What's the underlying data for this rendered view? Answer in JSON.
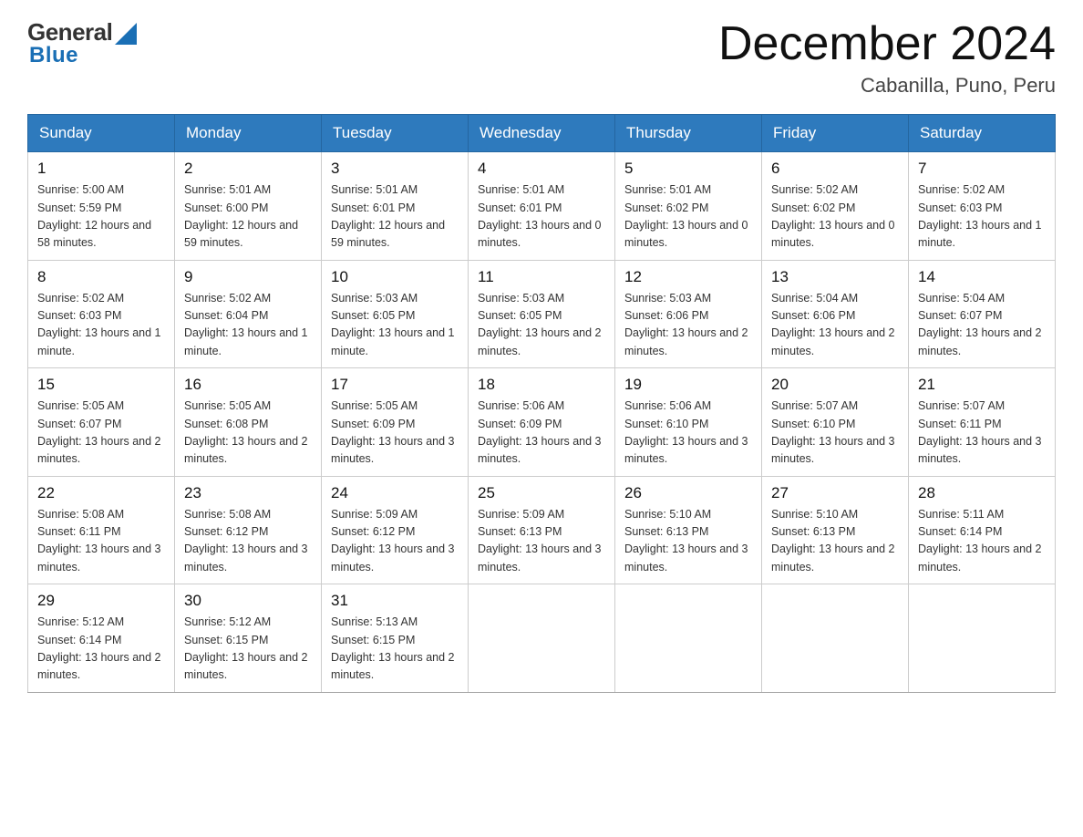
{
  "header": {
    "logo_general": "General",
    "logo_blue": "Blue",
    "month_title": "December 2024",
    "location": "Cabanilla, Puno, Peru"
  },
  "days_of_week": [
    "Sunday",
    "Monday",
    "Tuesday",
    "Wednesday",
    "Thursday",
    "Friday",
    "Saturday"
  ],
  "weeks": [
    [
      {
        "day": "1",
        "sunrise": "5:00 AM",
        "sunset": "5:59 PM",
        "daylight": "12 hours and 58 minutes."
      },
      {
        "day": "2",
        "sunrise": "5:01 AM",
        "sunset": "6:00 PM",
        "daylight": "12 hours and 59 minutes."
      },
      {
        "day": "3",
        "sunrise": "5:01 AM",
        "sunset": "6:01 PM",
        "daylight": "12 hours and 59 minutes."
      },
      {
        "day": "4",
        "sunrise": "5:01 AM",
        "sunset": "6:01 PM",
        "daylight": "13 hours and 0 minutes."
      },
      {
        "day": "5",
        "sunrise": "5:01 AM",
        "sunset": "6:02 PM",
        "daylight": "13 hours and 0 minutes."
      },
      {
        "day": "6",
        "sunrise": "5:02 AM",
        "sunset": "6:02 PM",
        "daylight": "13 hours and 0 minutes."
      },
      {
        "day": "7",
        "sunrise": "5:02 AM",
        "sunset": "6:03 PM",
        "daylight": "13 hours and 1 minute."
      }
    ],
    [
      {
        "day": "8",
        "sunrise": "5:02 AM",
        "sunset": "6:03 PM",
        "daylight": "13 hours and 1 minute."
      },
      {
        "day": "9",
        "sunrise": "5:02 AM",
        "sunset": "6:04 PM",
        "daylight": "13 hours and 1 minute."
      },
      {
        "day": "10",
        "sunrise": "5:03 AM",
        "sunset": "6:05 PM",
        "daylight": "13 hours and 1 minute."
      },
      {
        "day": "11",
        "sunrise": "5:03 AM",
        "sunset": "6:05 PM",
        "daylight": "13 hours and 2 minutes."
      },
      {
        "day": "12",
        "sunrise": "5:03 AM",
        "sunset": "6:06 PM",
        "daylight": "13 hours and 2 minutes."
      },
      {
        "day": "13",
        "sunrise": "5:04 AM",
        "sunset": "6:06 PM",
        "daylight": "13 hours and 2 minutes."
      },
      {
        "day": "14",
        "sunrise": "5:04 AM",
        "sunset": "6:07 PM",
        "daylight": "13 hours and 2 minutes."
      }
    ],
    [
      {
        "day": "15",
        "sunrise": "5:05 AM",
        "sunset": "6:07 PM",
        "daylight": "13 hours and 2 minutes."
      },
      {
        "day": "16",
        "sunrise": "5:05 AM",
        "sunset": "6:08 PM",
        "daylight": "13 hours and 2 minutes."
      },
      {
        "day": "17",
        "sunrise": "5:05 AM",
        "sunset": "6:09 PM",
        "daylight": "13 hours and 3 minutes."
      },
      {
        "day": "18",
        "sunrise": "5:06 AM",
        "sunset": "6:09 PM",
        "daylight": "13 hours and 3 minutes."
      },
      {
        "day": "19",
        "sunrise": "5:06 AM",
        "sunset": "6:10 PM",
        "daylight": "13 hours and 3 minutes."
      },
      {
        "day": "20",
        "sunrise": "5:07 AM",
        "sunset": "6:10 PM",
        "daylight": "13 hours and 3 minutes."
      },
      {
        "day": "21",
        "sunrise": "5:07 AM",
        "sunset": "6:11 PM",
        "daylight": "13 hours and 3 minutes."
      }
    ],
    [
      {
        "day": "22",
        "sunrise": "5:08 AM",
        "sunset": "6:11 PM",
        "daylight": "13 hours and 3 minutes."
      },
      {
        "day": "23",
        "sunrise": "5:08 AM",
        "sunset": "6:12 PM",
        "daylight": "13 hours and 3 minutes."
      },
      {
        "day": "24",
        "sunrise": "5:09 AM",
        "sunset": "6:12 PM",
        "daylight": "13 hours and 3 minutes."
      },
      {
        "day": "25",
        "sunrise": "5:09 AM",
        "sunset": "6:13 PM",
        "daylight": "13 hours and 3 minutes."
      },
      {
        "day": "26",
        "sunrise": "5:10 AM",
        "sunset": "6:13 PM",
        "daylight": "13 hours and 3 minutes."
      },
      {
        "day": "27",
        "sunrise": "5:10 AM",
        "sunset": "6:13 PM",
        "daylight": "13 hours and 2 minutes."
      },
      {
        "day": "28",
        "sunrise": "5:11 AM",
        "sunset": "6:14 PM",
        "daylight": "13 hours and 2 minutes."
      }
    ],
    [
      {
        "day": "29",
        "sunrise": "5:12 AM",
        "sunset": "6:14 PM",
        "daylight": "13 hours and 2 minutes."
      },
      {
        "day": "30",
        "sunrise": "5:12 AM",
        "sunset": "6:15 PM",
        "daylight": "13 hours and 2 minutes."
      },
      {
        "day": "31",
        "sunrise": "5:13 AM",
        "sunset": "6:15 PM",
        "daylight": "13 hours and 2 minutes."
      },
      null,
      null,
      null,
      null
    ]
  ]
}
